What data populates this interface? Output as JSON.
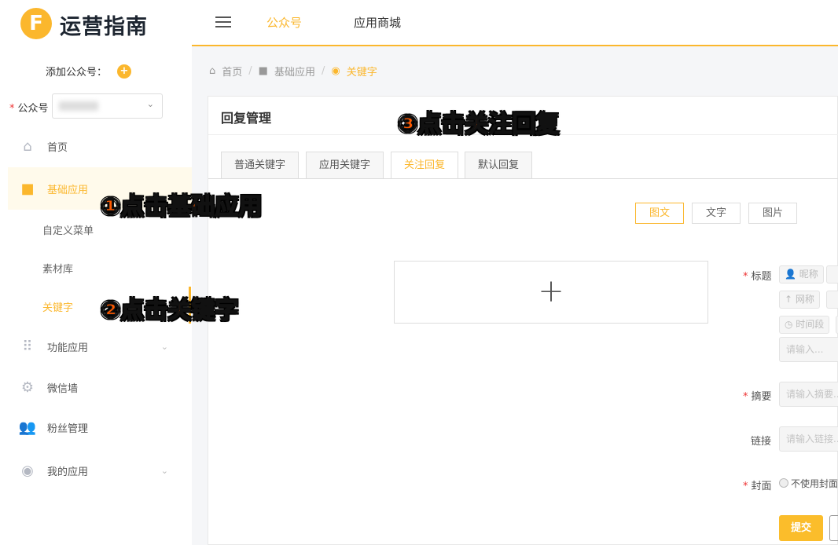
{
  "logo": {
    "letter": "F",
    "text": "运营指南"
  },
  "header": {
    "tabs": [
      {
        "label": "公众号",
        "active": true
      },
      {
        "label": "应用商城",
        "active": false
      }
    ]
  },
  "sidebar": {
    "add_account_label": "添加公众号：",
    "account_label": "公众号",
    "account_value": "",
    "items": [
      {
        "label": "首页",
        "icon": "home-icon"
      },
      {
        "label": "基础应用",
        "icon": "cube-icon",
        "active": true
      },
      {
        "label": "功能应用",
        "icon": "grid-icon"
      },
      {
        "label": "微信墙",
        "icon": "gear-icon"
      },
      {
        "label": "粉丝管理",
        "icon": "users-icon"
      },
      {
        "label": "我的应用",
        "icon": "chrome-icon"
      }
    ],
    "sub_items": [
      {
        "label": "自定义菜单"
      },
      {
        "label": "素材库"
      },
      {
        "label": "关键字",
        "active": true
      }
    ]
  },
  "breadcrumb": [
    "首页",
    "基础应用",
    "关键字"
  ],
  "card": {
    "title": "回复管理",
    "tabs": [
      "普通关键字",
      "应用关键字",
      "关注回复",
      "默认回复"
    ],
    "active_tab": "关注回复",
    "types": [
      "图文",
      "文字",
      "图片"
    ],
    "active_type": "图文",
    "form": {
      "title_label": "标题",
      "chips": [
        "昵称",
        "网称",
        "时间段"
      ],
      "title_placeholder": "请输入...",
      "summary_label": "摘要",
      "summary_placeholder": "请输入摘要...",
      "link_label": "链接",
      "link_placeholder": "请输入链接...",
      "cover_label": "封面",
      "cover_option": "不使用封面",
      "submit": "提交"
    }
  },
  "annotations": [
    "①点击基础应用",
    "②点击关键字",
    "③点击关注回复"
  ],
  "colors": {
    "accent": "#fbb72d",
    "annotation": "#ff5a00"
  }
}
